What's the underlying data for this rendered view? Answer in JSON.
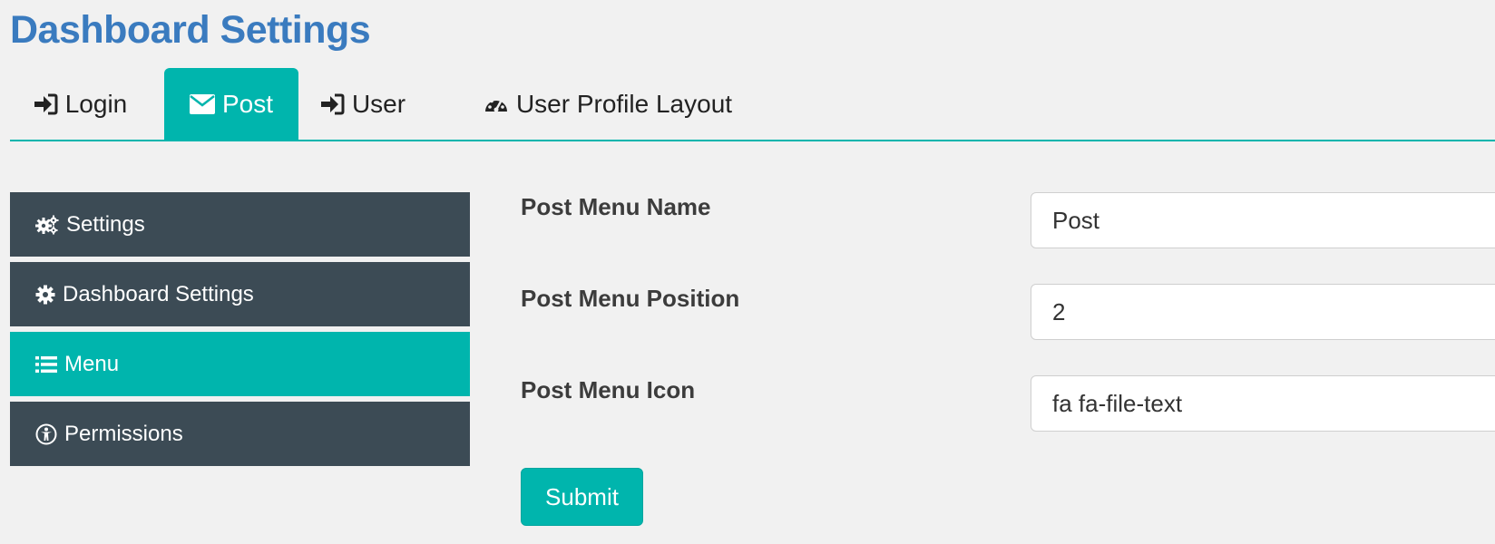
{
  "page": {
    "title": "Dashboard Settings"
  },
  "tabs": [
    {
      "label": "Login",
      "icon": "sign-in-icon",
      "active": false
    },
    {
      "label": "Post",
      "icon": "envelope-icon",
      "active": true
    },
    {
      "label": "User",
      "icon": "sign-in-icon",
      "active": false
    },
    {
      "label": "User Profile Layout",
      "icon": "dashboard-gauge-icon",
      "active": false
    }
  ],
  "sidebar": {
    "items": [
      {
        "label": "Settings",
        "icon": "gears-icon",
        "active": false
      },
      {
        "label": "Dashboard Settings",
        "icon": "gear-icon",
        "active": false
      },
      {
        "label": "Menu",
        "icon": "list-icon",
        "active": true
      },
      {
        "label": "Permissions",
        "icon": "universal-access-icon",
        "active": false
      }
    ]
  },
  "form": {
    "fields": [
      {
        "label": "Post Menu Name",
        "value": "Post"
      },
      {
        "label": "Post Menu Position",
        "value": "2"
      },
      {
        "label": "Post Menu Icon",
        "value": "fa fa-file-text"
      }
    ],
    "submit_label": "Submit"
  },
  "colors": {
    "accent": "#00b5ad",
    "title": "#3a7bbf",
    "sidebar_bg": "#3c4b55",
    "page_bg": "#f1f1f1"
  }
}
